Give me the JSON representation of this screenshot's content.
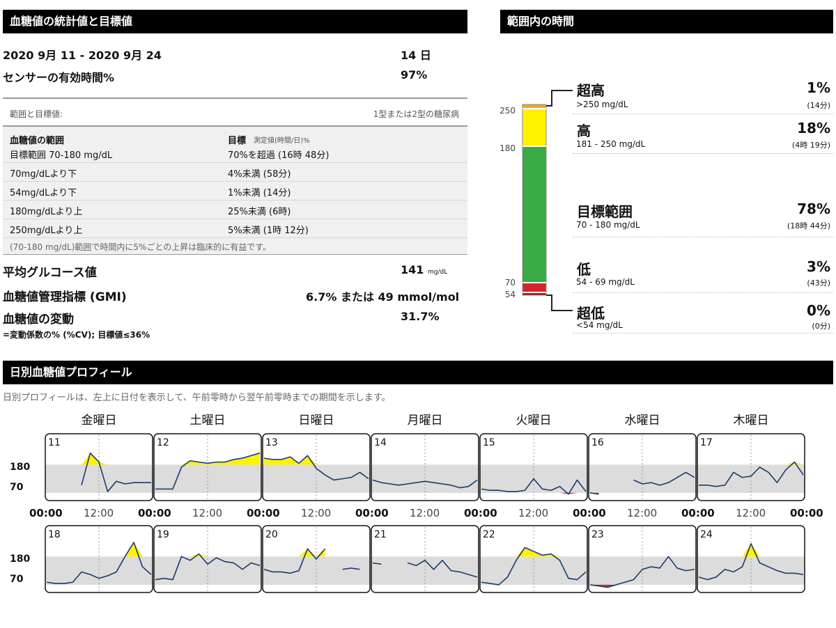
{
  "glucose_stats": {
    "title": "血糖値の統計値と目標値",
    "date_range": "2020 9月 11 - 2020 9月 24",
    "days": "14 日",
    "sensor_active_label": "センサーの有効時間%",
    "sensor_active_value": "97%",
    "targets_header_left": "範囲と目標値:",
    "targets_header_right": "1型または2型の糖尿病",
    "col1_title": "血糖値の範囲",
    "col2_title": "目標",
    "col2_sub": "測定値(時間/日)%",
    "rows": [
      {
        "range": "目標範囲 70-180 mg/dL",
        "target": "70%を超過 (16時 48分)"
      },
      {
        "range": "70mg/dLより下",
        "target": "4%未満 (58分)"
      },
      {
        "range": "54mg/dLより下",
        "target": "1%未満 (14分)"
      },
      {
        "range": "180mg/dLより上",
        "target": "25%未満 (6時)"
      },
      {
        "range": "250mg/dLより上",
        "target": "5%未満 (1時 12分)"
      }
    ],
    "note": "(70-180 mg/dL)範囲で時間内に5%ごとの上昇は臨床的に有益です。",
    "avg_glucose_label": "平均グルコース値",
    "avg_glucose_value": "141",
    "avg_glucose_unit": "mg/dL",
    "gmi_label": "血糖値管理指標 (GMI)",
    "gmi_value": "6.7% または 49 mmol/mol",
    "variability_label": "血糖値の変動",
    "variability_value": "31.7%",
    "variability_note": "=変動係数の% (%CV); 目標値≤36%"
  },
  "time_in_range": {
    "title": "範囲内の時間",
    "axis_labels": [
      "250",
      "180",
      "70",
      "54"
    ],
    "bands": [
      {
        "label": "超高",
        "range": ">250 mg/dL",
        "pct": "1%",
        "time": "(14分)",
        "value": 1,
        "color": "#f5a623"
      },
      {
        "label": "高",
        "range": "181 - 250 mg/dL",
        "pct": "18%",
        "time": "(4時 19分)",
        "value": 18,
        "color": "#fff200"
      },
      {
        "label": "目標範囲",
        "range": "70 - 180 mg/dL",
        "pct": "78%",
        "time": "(18時 44分)",
        "value": 78,
        "color": "#3aaa44"
      },
      {
        "label": "低",
        "range": "54 - 69 mg/dL",
        "pct": "3%",
        "time": "(43分)",
        "value": 3,
        "color": "#d9232a"
      },
      {
        "label": "超低",
        "range": "<54 mg/dL",
        "pct": "0%",
        "time": "(0分)",
        "value": 0,
        "color": "#a0151b"
      }
    ]
  },
  "daily_profile": {
    "title": "日別血糖値プロフィール",
    "description": "日別プロフィールは、左上に日付を表示して、午前零時から翌午前零時までの期間を示します。",
    "weekdays": [
      "金曜日",
      "土曜日",
      "日曜日",
      "月曜日",
      "火曜日",
      "水曜日",
      "木曜日"
    ],
    "y_labels": [
      "180",
      "70"
    ],
    "time_labels_week1": [
      "00:00",
      "12:00",
      "00:00",
      "12:00",
      "00:00",
      "12:00",
      "00:00",
      "12:00",
      "00:00",
      "12:00",
      "00:00",
      "12:00",
      "00:00",
      "12:00",
      "00:00"
    ]
  },
  "chart_data": {
    "type": "line",
    "ylim": [
      40,
      300
    ],
    "target_band": [
      70,
      180
    ],
    "x": [
      "0:00",
      "2:00",
      "4:00",
      "6:00",
      "8:00",
      "10:00",
      "12:00",
      "14:00",
      "16:00",
      "18:00",
      "20:00",
      "22:00",
      "24:00"
    ],
    "days": [
      {
        "date": "11",
        "values": [
          null,
          null,
          null,
          null,
          100,
          225,
          190,
          75,
          115,
          105,
          110,
          110,
          110
        ]
      },
      {
        "date": "12",
        "values": [
          85,
          85,
          85,
          170,
          195,
          190,
          185,
          190,
          190,
          200,
          205,
          215,
          225
        ]
      },
      {
        "date": "13",
        "values": [
          205,
          200,
          200,
          210,
          185,
          215,
          165,
          140,
          120,
          125,
          130,
          150,
          125
        ]
      },
      {
        "date": "14",
        "values": [
          120,
          110,
          105,
          100,
          105,
          110,
          115,
          110,
          105,
          100,
          90,
          95,
          120
        ]
      },
      {
        "date": "15",
        "values": [
          85,
          80,
          80,
          75,
          75,
          80,
          125,
          85,
          80,
          95,
          65,
          120,
          75
        ]
      },
      {
        "date": "16",
        "values": [
          70,
          65,
          null,
          null,
          null,
          120,
          105,
          110,
          100,
          110,
          130,
          150,
          130
        ]
      },
      {
        "date": "17",
        "values": [
          100,
          100,
          95,
          100,
          150,
          130,
          135,
          170,
          150,
          110,
          160,
          190,
          140
        ]
      },
      {
        "date": "18",
        "values": [
          80,
          75,
          75,
          80,
          120,
          110,
          95,
          105,
          120,
          180,
          235,
          140,
          110
        ]
      },
      {
        "date": "19",
        "values": [
          90,
          95,
          90,
          180,
          165,
          190,
          150,
          175,
          160,
          155,
          130,
          155,
          145
        ]
      },
      {
        "date": "20",
        "values": [
          130,
          120,
          120,
          115,
          125,
          210,
          170,
          210,
          null,
          130,
          135,
          130,
          null
        ]
      },
      {
        "date": "21",
        "values": [
          155,
          150,
          null,
          null,
          155,
          145,
          165,
          130,
          165,
          125,
          120,
          110,
          100
        ]
      },
      {
        "date": "22",
        "values": [
          80,
          75,
          70,
          100,
          165,
          215,
          200,
          185,
          190,
          165,
          95,
          90,
          120
        ]
      },
      {
        "date": "23",
        "values": [
          70,
          65,
          60,
          70,
          80,
          90,
          130,
          140,
          135,
          180,
          135,
          125,
          130
        ]
      },
      {
        "date": "24",
        "values": [
          100,
          90,
          100,
          130,
          120,
          140,
          230,
          155,
          140,
          125,
          115,
          115,
          110
        ]
      }
    ]
  }
}
